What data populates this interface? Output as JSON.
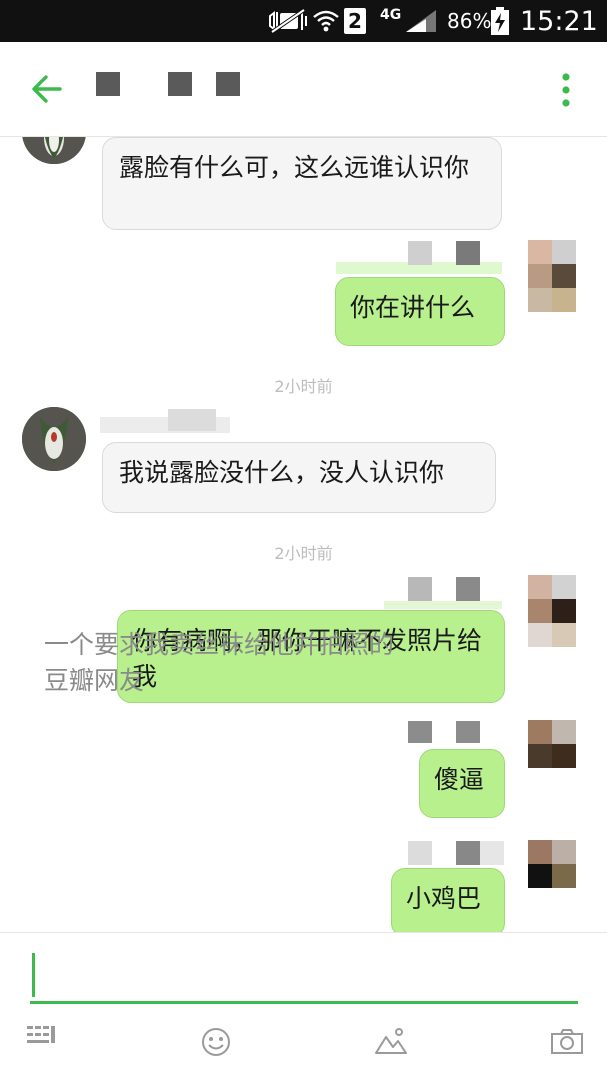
{
  "status_bar": {
    "network": "4G",
    "sim_slot": "2",
    "battery": "86%",
    "time": "15:21"
  },
  "icons": {
    "back": "arrow-left-icon",
    "menu": "more-vert-icon",
    "emoji": "smiley-icon",
    "image": "picture-icon",
    "camera": "camera-icon"
  },
  "colors": {
    "accent": "#3dba4e",
    "outgoing_bubble": "#b8f08e",
    "incoming_bubble": "#f5f5f5"
  },
  "messages": [
    {
      "direction": "in",
      "text": "露脸有什么可，这么远谁认识你"
    },
    {
      "direction": "out",
      "text": "你在讲什么"
    },
    {
      "direction": "in",
      "text": "我说露脸没什么，没人认识你"
    },
    {
      "direction": "out",
      "text": "你有病啊，那你干嘛不发照片给我"
    },
    {
      "direction": "out",
      "text": "傻逼"
    },
    {
      "direction": "out",
      "text": "小鸡巴"
    }
  ],
  "timestamps": [
    "2小时前",
    "2小时前"
  ],
  "caption": "一个要求我卖丝袜给他并拍照的豆瓣网友",
  "composer": {
    "value": ""
  }
}
